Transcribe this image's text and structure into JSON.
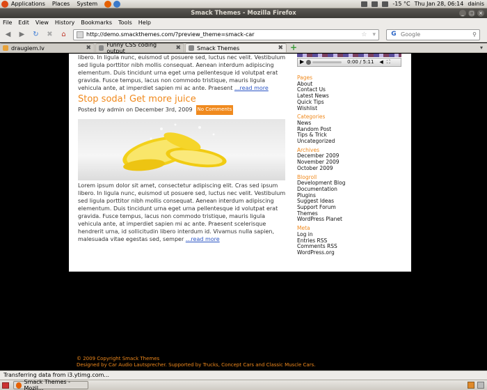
{
  "top_panel": {
    "menus": [
      "Applications",
      "Places",
      "System"
    ],
    "temperature": "-15 °C",
    "clock": "Thu Jan 28, 06:14",
    "user": "dainis"
  },
  "window": {
    "title": "Smack Themes - Mozilla Firefox"
  },
  "menubar": [
    "File",
    "Edit",
    "View",
    "History",
    "Bookmarks",
    "Tools",
    "Help"
  ],
  "nav": {
    "url": "http://demo.smackthemes.com/?preview_theme=smack-car",
    "search_placeholder": "Google"
  },
  "tabs": [
    {
      "label": "draugiem.lv",
      "active": false
    },
    {
      "label": "Funny CSS coding output",
      "active": false
    },
    {
      "label": "Smack Themes",
      "active": true
    }
  ],
  "posts": {
    "prev_excerpt": "libero. In ligula nunc, euismod ut posuere sed, luctus nec velit. Vestibulum sed ligula porttitor nibh mollis consequat. Aenean interdum adipiscing elementum. Duis tincidunt urna eget urna pellentesque id volutpat erat gravida. Fusce tempus, lacus non commodo tristique, mauris ligula vehicula ante, at imperdiet sapien mi ac ante. Praesent",
    "prev_more": "...read more",
    "title": "Stop soda! Get more juice",
    "meta": "Posted by admin on December 3rd, 2009",
    "comments_badge": "No Comments",
    "body": "Lorem ipsum dolor sit amet, consectetur adipiscing elit. Cras sed ipsum libero. In ligula nunc, euismod ut posuere sed, luctus nec velit. Vestibulum sed ligula porttitor nibh mollis consequat. Aenean interdum adipiscing elementum. Duis tincidunt urna eget urna pellentesque id volutpat erat gravida. Fusce tempus, lacus non commodo tristique, mauris ligula vehicula ante, at imperdiet sapien mi ac ante. Praesent scelerisque hendrerit urna, id sollicitudin libero interdum id. Vivamus nulla sapien, malesuada vitae egestas sed, semper",
    "more": "...read more"
  },
  "player": {
    "time": "0:00 / 5:11"
  },
  "sidebar": {
    "pages": {
      "title": "Pages",
      "items": [
        "About",
        "Contact Us",
        "Latest News",
        "Quick Tips",
        "Wishlist"
      ]
    },
    "categories": {
      "title": "Categories",
      "items": [
        "News",
        "Random Post",
        "Tips & Trick",
        "Uncategorized"
      ]
    },
    "archives": {
      "title": "Archives",
      "items": [
        "December 2009",
        "November 2009",
        "October 2009"
      ]
    },
    "blogroll": {
      "title": "Blogroll",
      "items": [
        "Development Blog",
        "Documentation",
        "Plugins",
        "Suggest Ideas",
        "Support Forum",
        "Themes",
        "WordPress Planet"
      ]
    },
    "meta": {
      "title": "Meta",
      "items": [
        "Log in",
        "Entries RSS",
        "Comments RSS",
        "WordPress.org"
      ]
    }
  },
  "footer": {
    "copyright": "© 2009 Copyright Smack Themes",
    "credits": "Designed by Car Audio Lautsprecher. Supported by Trucks, Concept Cars and Classic Muscle Cars."
  },
  "status": "Transferring data from i3.ytimg.com...",
  "taskbar": {
    "task_label": "Smack Themes - Mozil..."
  },
  "colors": {
    "accent": "#f0891c",
    "link": "#2a54c4",
    "page_bg": "#000000"
  }
}
